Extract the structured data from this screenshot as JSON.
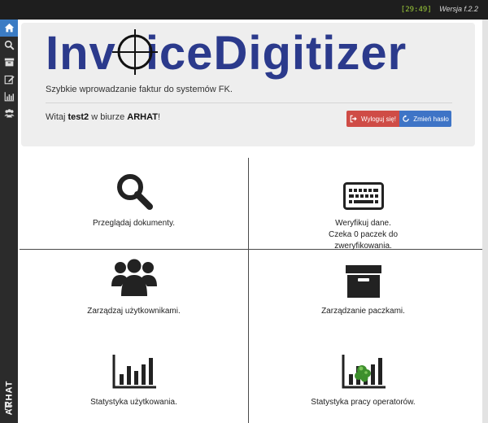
{
  "topbar": {
    "clock": "[29:49]",
    "version": "Wersja f.2.2"
  },
  "sidebar": {
    "items": [
      {
        "icon": "home-icon"
      },
      {
        "icon": "search-icon"
      },
      {
        "icon": "archive-icon"
      },
      {
        "icon": "edit-icon"
      },
      {
        "icon": "bar-chart-icon"
      },
      {
        "icon": "users-icon"
      }
    ],
    "office_label": "ARHAT",
    "logout_icon": "logout-icon"
  },
  "header": {
    "logo_left": "Inv",
    "logo_right": "iceDigitizer",
    "tagline": "Szybkie wprowadzanie faktur do systemów FK.",
    "welcome_prefix": "Witaj ",
    "user": "test2",
    "welcome_middle": " w biurze ",
    "office": "ARHAT",
    "welcome_suffix": "!",
    "logout_label": "Wyloguj się!",
    "change_password_label": "Zmień hasło"
  },
  "tiles": {
    "browse": {
      "label": "Przeglądaj dokumenty."
    },
    "verify": {
      "label": "Weryfikuj dane.\nCzeka 0 paczek do\nzweryfikowania."
    },
    "users": {
      "label": "Zarządzaj użytkownikami."
    },
    "packages": {
      "label": "Zarządzanie paczkami."
    },
    "usage_stats": {
      "label": "Statystyka użytkowania."
    },
    "operator_stats": {
      "label": "Statystyka pracy operatorów."
    }
  },
  "colors": {
    "brand": "#2b3a8c",
    "danger": "#cf4c46",
    "primary": "#3e74c6",
    "sidebar_active": "#3b7cc4"
  }
}
